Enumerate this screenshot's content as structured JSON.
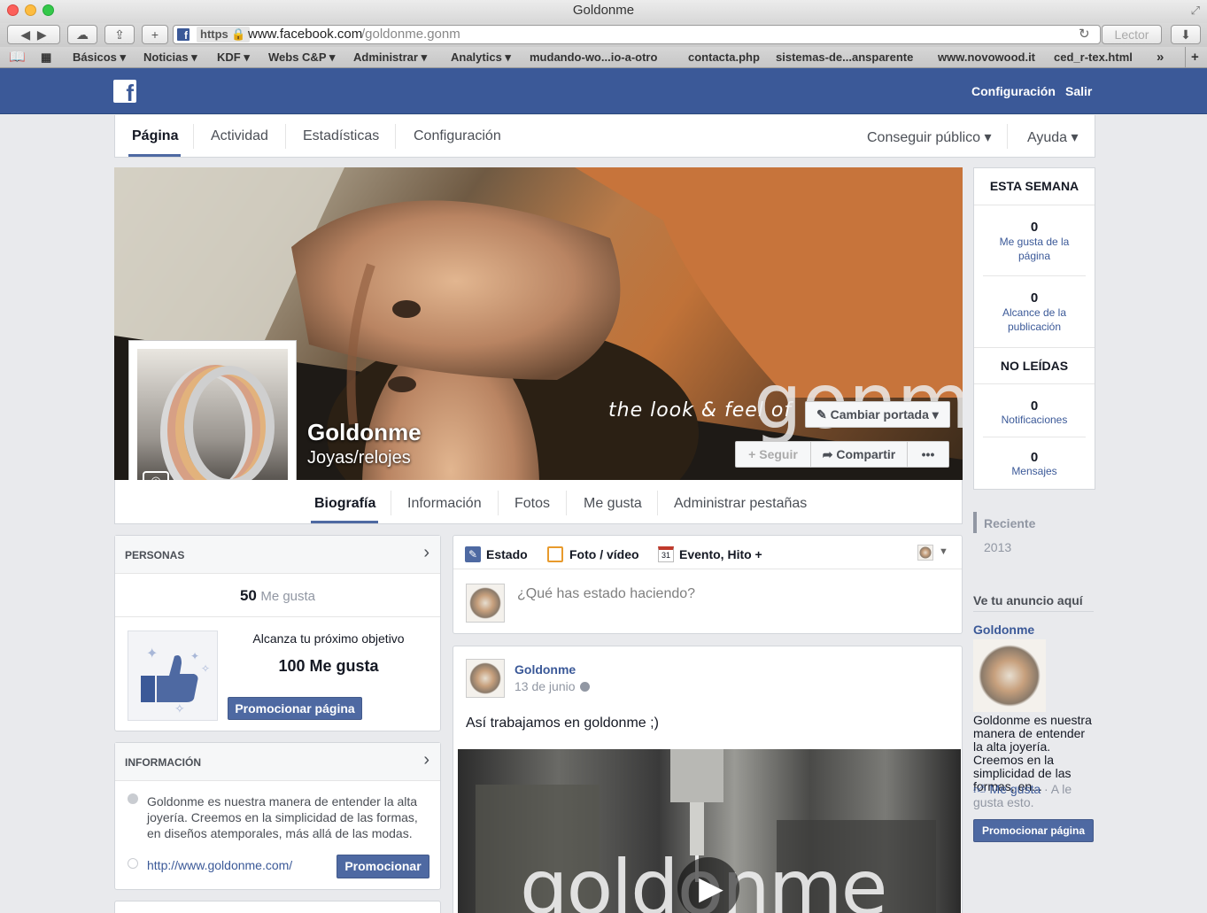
{
  "browser": {
    "title": "Goldonme",
    "url_scheme": "https",
    "url_host": "www.facebook.com",
    "url_path": "/goldonme.gonm",
    "reader_label": "Lector",
    "bookmarks": [
      "Básicos ▾",
      "Noticias ▾",
      "KDF ▾",
      "Webs C&P ▾",
      "Administrar ▾",
      "Analytics ▾",
      "mudando-wo...io-a-otro",
      "contacta.php",
      "sistemas-de...ansparente",
      "www.novowood.it",
      "ced_r-tex.html",
      "»"
    ]
  },
  "fb": {
    "settings": "Configuración",
    "logout": "Salir"
  },
  "admin_tabs": [
    "Página",
    "Actividad",
    "Estadísticas",
    "Configuración"
  ],
  "admin_right": [
    "Conseguir público ▾",
    "Ayuda ▾"
  ],
  "cover": {
    "name": "Goldonme",
    "category": "Joyas/relojes",
    "tagline": "the look & feel of",
    "brand_overlay": "gonm",
    "change_cover": "Cambiar portada ▾",
    "follow": "Seguir",
    "share": "Compartir",
    "more": "•••"
  },
  "page_tabs": [
    "Biografía",
    "Información",
    "Fotos",
    "Me gusta",
    "Administrar pestañas"
  ],
  "week": {
    "title": "ESTA SEMANA",
    "likes_value": "0",
    "likes_label": "Me gusta de la página",
    "reach_value": "0",
    "reach_label": "Alcance de la publicación",
    "unread_title": "NO LEÍDAS",
    "notif_value": "0",
    "notif_label": "Notificaciones",
    "msg_value": "0",
    "msg_label": "Mensajes"
  },
  "timeline": [
    "Reciente",
    "2013"
  ],
  "people": {
    "title": "PERSONAS",
    "likes_count": "50",
    "likes_label": "Me gusta",
    "goal_text": "Alcanza tu próximo objetivo",
    "goal_value": "100 Me gusta",
    "promote": "Promocionar página"
  },
  "info": {
    "title": "INFORMACIÓN",
    "description": "Goldonme es nuestra manera de entender la alta joyería. Creemos en la simplicidad de las formas, en diseños atemporales, más allá de las modas.",
    "url": "http://www.goldonme.com/",
    "promote": "Promocionar"
  },
  "composer": {
    "status": "Estado",
    "photo": "Foto / vídeo",
    "event": "Evento, Hito +",
    "calendar_day": "31",
    "placeholder": "¿Qué has estado haciendo?"
  },
  "post": {
    "author": "Goldonme",
    "date": "13 de junio",
    "text": "Así trabajamos en goldonme ;)",
    "video_brand": "goldonme"
  },
  "ad": {
    "header": "Ve tu anuncio aquí",
    "name": "Goldonme",
    "text": "Goldonme es nuestra manera de entender la alta joyería. Creemos en la simplicidad de las formas, en...",
    "like": "Me gusta",
    "like_suffix": "· A le gusta esto.",
    "promote": "Promocionar página"
  }
}
